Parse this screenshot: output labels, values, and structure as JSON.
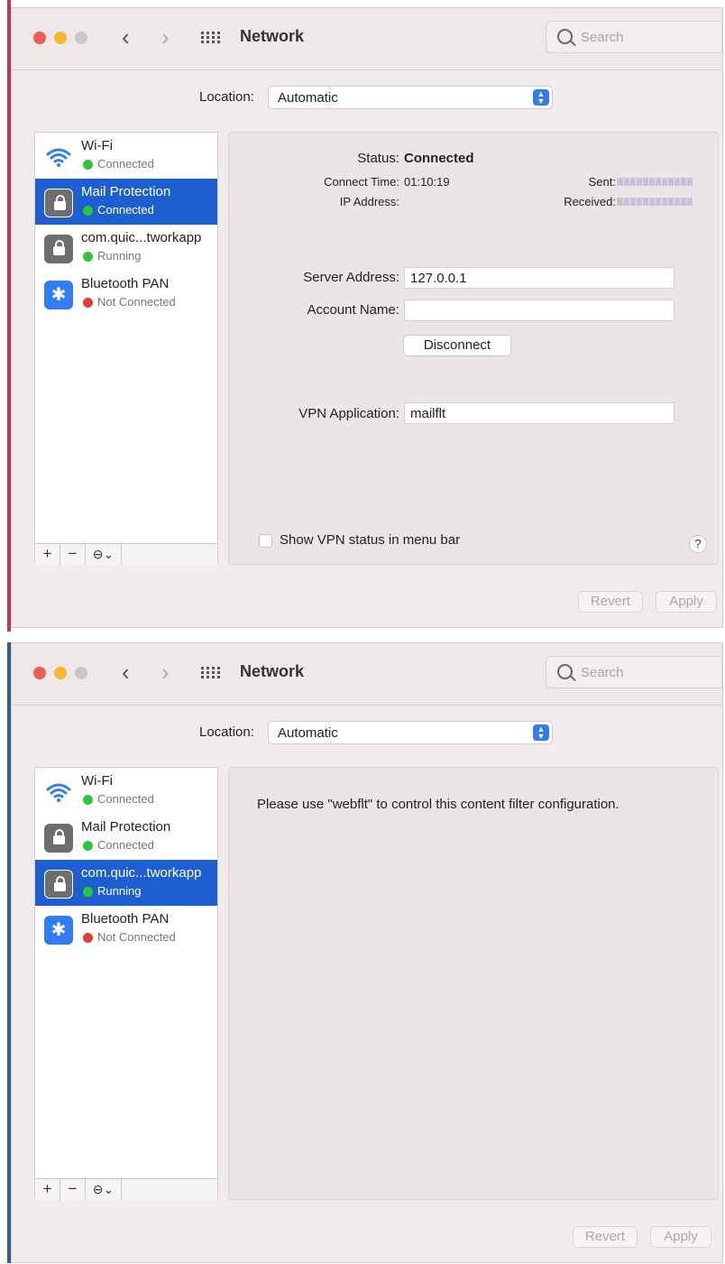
{
  "window1": {
    "title": "Network",
    "search_placeholder": "Search",
    "location_label": "Location:",
    "location_value": "Automatic",
    "services": [
      {
        "name": "Wi-Fi",
        "status": "Connected",
        "icon": "wifi-icon",
        "status_color": "#2ec53a"
      },
      {
        "name": "Mail Protection",
        "status": "Connected",
        "icon": "lock-icon",
        "status_color": "#2ec53a"
      },
      {
        "name": "com.quic...tworkapp",
        "status": "Running",
        "icon": "lock-icon",
        "status_color": "#2ec53a"
      },
      {
        "name": "Bluetooth PAN",
        "status": "Not Connected",
        "icon": "bluetooth-icon",
        "status_color": "#e53a35"
      }
    ],
    "selected_service": "Mail Protection",
    "detail": {
      "status_label": "Status:",
      "status_value": "Connected",
      "connect_time_label": "Connect Time:",
      "connect_time_value": "01:10:19",
      "ip_address_label": "IP Address:",
      "sent_label": "Sent:",
      "received_label": "Received:",
      "server_address_label": "Server Address:",
      "server_address_value": "127.0.0.1",
      "account_name_label": "Account Name:",
      "account_name_value": "",
      "disconnect_label": "Disconnect",
      "vpn_application_label": "VPN Application:",
      "vpn_application_value": "mailflt",
      "show_vpn_status_label": "Show VPN status in menu bar",
      "help_label": "?"
    },
    "footer": {
      "revert_label": "Revert",
      "apply_label": "Apply"
    }
  },
  "window2": {
    "title": "Network",
    "search_placeholder": "Search",
    "location_label": "Location:",
    "location_value": "Automatic",
    "services": [
      {
        "name": "Wi-Fi",
        "status": "Connected",
        "icon": "wifi-icon",
        "status_color": "#2ec53a"
      },
      {
        "name": "Mail Protection",
        "status": "Connected",
        "icon": "lock-icon",
        "status_color": "#2ec53a"
      },
      {
        "name": "com.quic...tworkapp",
        "status": "Running",
        "icon": "lock-icon",
        "status_color": "#2ec53a"
      },
      {
        "name": "Bluetooth PAN",
        "status": "Not Connected",
        "icon": "bluetooth-icon",
        "status_color": "#e53a35"
      }
    ],
    "selected_service": "com.quic...tworkapp",
    "detail": {
      "message": "Please use \"webflt\" to control this content filter configuration."
    },
    "footer": {
      "revert_label": "Revert",
      "apply_label": "Apply"
    }
  },
  "sidebar_footer": {
    "add_label": "+",
    "remove_label": "−",
    "action_label": "⊖⌄"
  },
  "colors": {
    "selection": "#1d5fd0",
    "accent_blue": "#2f7cf5",
    "status_green": "#2ec53a",
    "status_red": "#e53a35"
  }
}
